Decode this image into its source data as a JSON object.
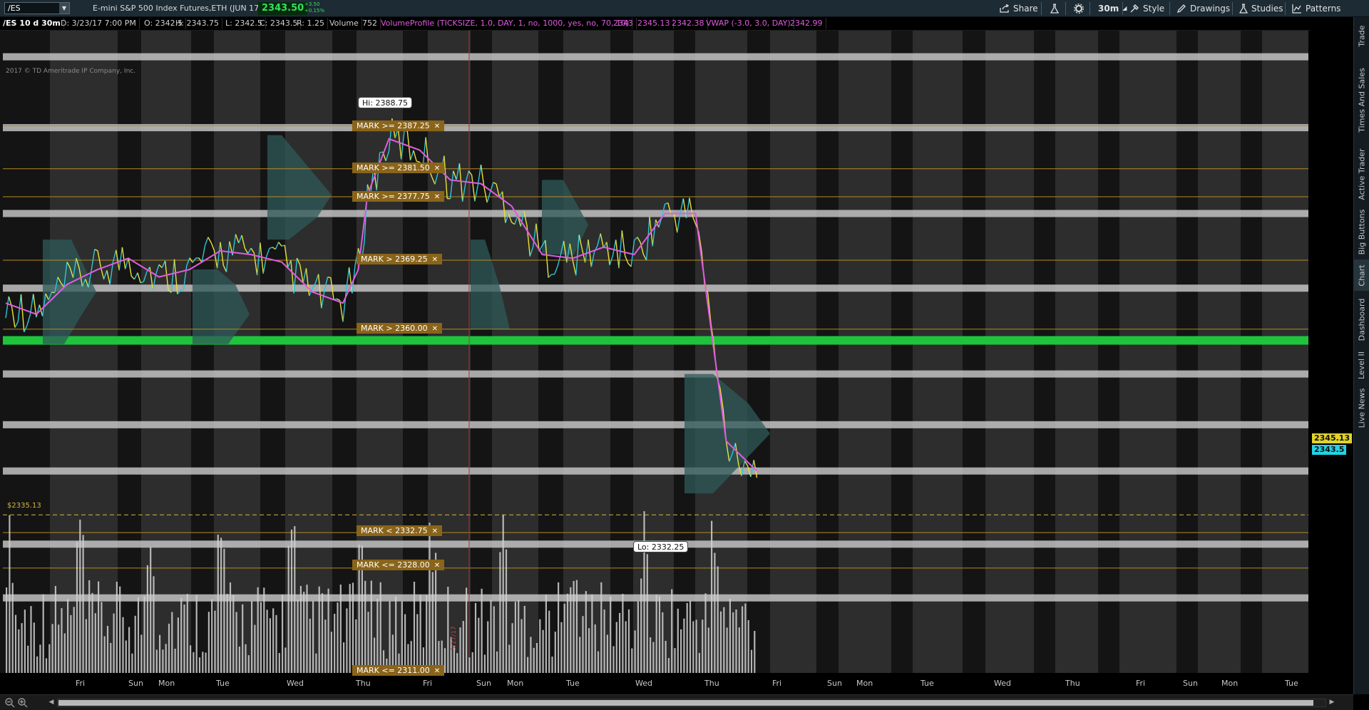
{
  "toolbar": {
    "symbol": "/ES",
    "description": "E-mini S&P 500 Index Futures,ETH (JUN 17)",
    "last_price": "2343.50",
    "change_abs": "+3.50",
    "change_pct": "+0.15%",
    "buttons": {
      "share": "Share",
      "aggregation": "30m",
      "style": "Style",
      "drawings": "Drawings",
      "studies": "Studies",
      "patterns": "Patterns"
    }
  },
  "infobar": {
    "period": "/ES 10 d 30m",
    "date": "D: 3/23/17 7:00 PM",
    "open": "O: 2342.5",
    "high": "H: 2343.75",
    "low": "L: 2342.5",
    "close": "C: 2343.5",
    "range": "R: 1.25",
    "volume_label": "Volume",
    "volume_value": "752",
    "vp_label": "VolumeProfile (TICKSIZE, 1.0, DAY, 1, no, 1000, yes, no, 70, 10)",
    "vp_v1": "2343",
    "vp_v2": "2345.13",
    "vp_v3": "2342.38",
    "vwap_label": "VWAP (-3.0, 3.0, DAY)",
    "vwap_value": "2342.99"
  },
  "chart": {
    "copyright": "2017 © TD Ameritrade IP Company, Inc.",
    "hi_label": "Hi: 2388.75",
    "lo_label": "Lo: 2332.25",
    "dashed_label": "$2335.13",
    "vertical_date": "3/17/17",
    "price_badges": {
      "upper": "2345.13",
      "lower": "2343.5"
    },
    "marks": [
      {
        "text": "MARK >= 2387.25",
        "price": 2387.25
      },
      {
        "text": "MARK >= 2381.50",
        "price": 2381.5
      },
      {
        "text": "MARK >= 2377.75",
        "price": 2377.75
      },
      {
        "text": "MARK > 2369.25",
        "price": 2369.25
      },
      {
        "text": "MARK > 2360.00",
        "price": 2360.0
      },
      {
        "text": "MARK < 2332.75",
        "price": 2332.75
      },
      {
        "text": "MARK <= 2328.00",
        "price": 2328.0
      },
      {
        "text": "MARK <= 2311.00",
        "price": 2311.0
      }
    ],
    "colors": {
      "background": "#000000",
      "session_band": "#3a3a3a",
      "level_band": "#c8c8c8",
      "green_level": "#1ec43c",
      "price_up": "#2ec6d8",
      "price_down": "#e8e23a",
      "vwap": "#e05ce0",
      "mark_line": "#b78a22",
      "profile": "#2f5a5a",
      "volume": "#d0d0d0"
    }
  },
  "chart_data": {
    "type": "line",
    "y_axis_ticks": [
      "2400",
      "2395",
      "2390",
      "2385",
      "2380",
      "2375",
      "2370",
      "2365",
      "2360",
      "2355",
      "2350",
      "2345",
      "2340",
      "2335",
      "2330",
      "2325",
      "2320",
      "2315"
    ],
    "ylim": [
      2312,
      2400
    ],
    "x_axis_labels": [
      "Fri",
      "Sun",
      "Mon",
      "Tue",
      "Wed",
      "Thu",
      "Fri",
      "Sun",
      "Mon",
      "Tue",
      "Wed",
      "Thu",
      "Fri",
      "Sun",
      "Mon",
      "Tue",
      "Wed",
      "Thu",
      "Fri",
      "Sun",
      "Mon",
      "Tue"
    ],
    "level_bands": [
      2396.5,
      2387,
      2375.5,
      2365.5,
      2354,
      2347.2,
      2341,
      2331.2,
      2324
    ],
    "green_level": 2358.5,
    "dashed_level": 2335.13,
    "series": [
      {
        "name": "VWAP",
        "x": [
          0,
          10,
          20,
          30,
          40,
          50,
          60,
          70,
          80,
          90,
          100,
          110,
          115,
          118,
          125,
          135,
          145,
          155,
          165,
          175,
          185,
          195,
          205,
          215,
          225,
          235,
          245
        ],
        "values": [
          2363.5,
          2362,
          2366,
          2368,
          2369.5,
          2367,
          2368,
          2370.5,
          2370,
          2369,
          2365,
          2363.5,
          2368,
          2378,
          2385.5,
          2384,
          2380,
          2379.5,
          2376.5,
          2370,
          2369.5,
          2371,
          2370,
          2375.5,
          2375.5,
          2345,
          2341
        ]
      }
    ]
  },
  "sidetabs": [
    "Trade",
    "Times And Sales",
    "Active Trader",
    "Big Buttons",
    "Chart",
    "Dashboard",
    "Level II",
    "Live News"
  ]
}
